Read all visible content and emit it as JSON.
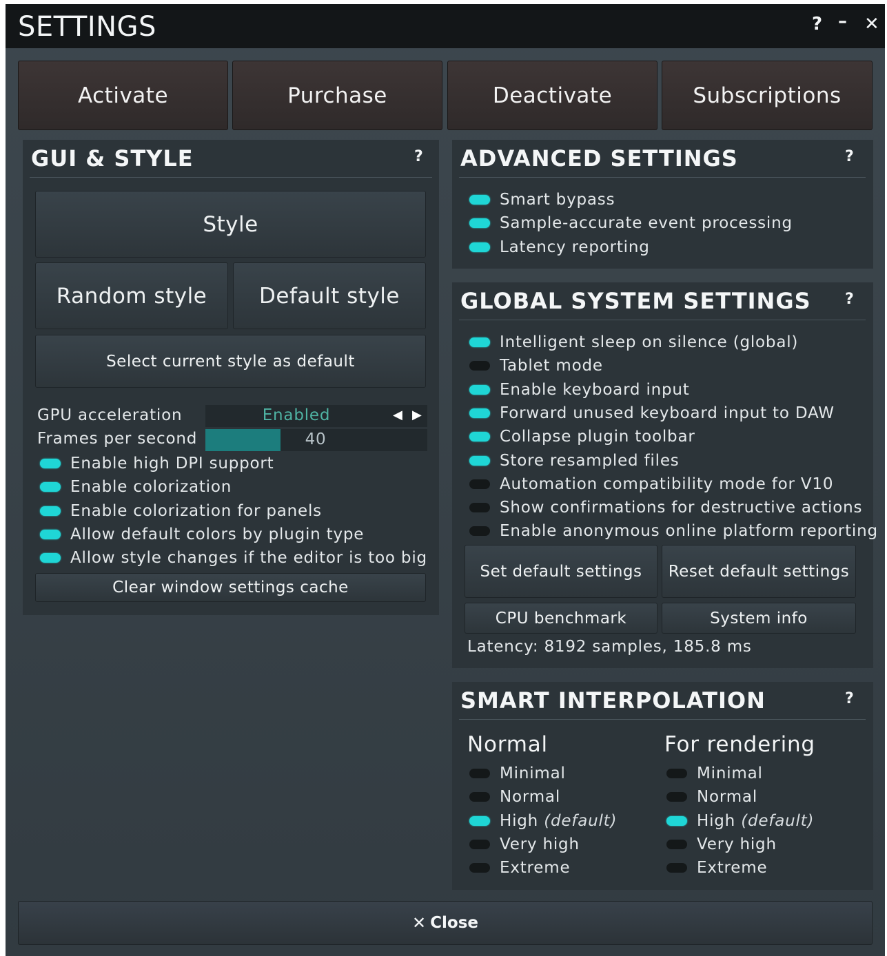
{
  "window": {
    "title": "SETTINGS",
    "help_label": "?",
    "minimize_label": "–",
    "close_label": "✕"
  },
  "top_buttons": [
    "Activate",
    "Purchase",
    "Deactivate",
    "Subscriptions"
  ],
  "gui_style": {
    "title": "GUI & STYLE",
    "help": "?",
    "style_button": "Style",
    "random_style_button": "Random style",
    "default_style_button": "Default style",
    "select_default_button": "Select current style as default",
    "gpu_label": "GPU acceleration",
    "gpu_value": "Enabled",
    "fps_label": "Frames per second",
    "fps_value": "40",
    "fps_fill_fraction": 0.34,
    "toggles": [
      {
        "label": "Enable high DPI support",
        "on": true
      },
      {
        "label": "Enable colorization",
        "on": true
      },
      {
        "label": "Enable colorization for panels",
        "on": true
      },
      {
        "label": "Allow default colors by plugin type",
        "on": true
      },
      {
        "label": "Allow style changes if the editor is too big",
        "on": true
      }
    ],
    "clear_cache_button": "Clear window settings cache"
  },
  "advanced": {
    "title": "ADVANCED SETTINGS",
    "help": "?",
    "toggles": [
      {
        "label": "Smart bypass",
        "on": true
      },
      {
        "label": "Sample-accurate event processing",
        "on": true
      },
      {
        "label": "Latency reporting",
        "on": true
      }
    ]
  },
  "global": {
    "title": "GLOBAL SYSTEM SETTINGS",
    "help": "?",
    "toggles": [
      {
        "label": "Intelligent sleep on silence (global)",
        "on": true
      },
      {
        "label": "Tablet mode",
        "on": false
      },
      {
        "label": "Enable keyboard input",
        "on": true
      },
      {
        "label": "Forward unused keyboard input to DAW",
        "on": true
      },
      {
        "label": "Collapse plugin toolbar",
        "on": true
      },
      {
        "label": "Store resampled files",
        "on": true
      },
      {
        "label": "Automation compatibility mode for V10",
        "on": false
      },
      {
        "label": "Show confirmations for destructive actions",
        "on": false
      },
      {
        "label": "Enable anonymous online platform reporting",
        "on": false
      }
    ],
    "set_default_button": "Set default settings",
    "reset_default_button": "Reset default settings",
    "cpu_benchmark_button": "CPU benchmark",
    "system_info_button": "System info",
    "latency_text": "Latency: 8192 samples, 185.8 ms"
  },
  "smart_interpolation": {
    "title": "SMART INTERPOLATION",
    "help": "?",
    "normal": {
      "heading": "Normal",
      "options": [
        {
          "label": "Minimal",
          "suffix": "",
          "on": false
        },
        {
          "label": "Normal",
          "suffix": "",
          "on": false
        },
        {
          "label": "High ",
          "suffix": "(default)",
          "on": true
        },
        {
          "label": "Very high",
          "suffix": "",
          "on": false
        },
        {
          "label": "Extreme",
          "suffix": "",
          "on": false
        }
      ]
    },
    "rendering": {
      "heading": "For rendering",
      "options": [
        {
          "label": "Minimal",
          "suffix": "",
          "on": false
        },
        {
          "label": "Normal",
          "suffix": "",
          "on": false
        },
        {
          "label": "High ",
          "suffix": "(default)",
          "on": true
        },
        {
          "label": "Very high",
          "suffix": "",
          "on": false
        },
        {
          "label": "Extreme",
          "suffix": "",
          "on": false
        }
      ]
    }
  },
  "footer": {
    "close_icon": "✕",
    "close_label": "Close"
  },
  "colors": {
    "toggle_on": "#1fd6d6",
    "toggle_off": "#141819",
    "fps_fill": "#1c7d7d",
    "gpu_value_text": "#4fb3a3"
  }
}
